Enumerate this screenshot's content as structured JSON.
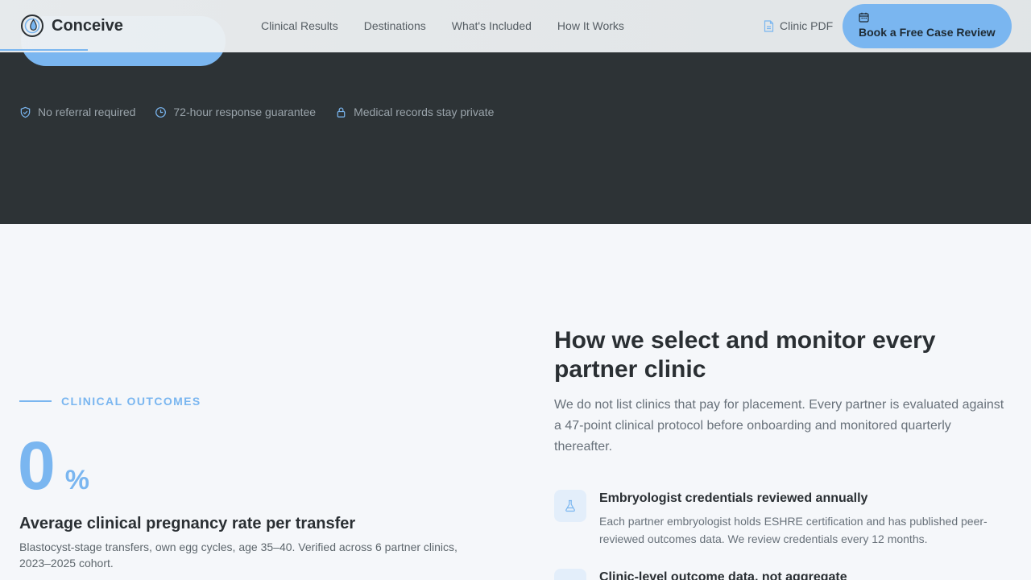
{
  "brand": {
    "name": "Conceive",
    "logo_icon": "droplet-in-circle-icon"
  },
  "nav": {
    "items": [
      "Clinical Results",
      "Destinations",
      "What's Included",
      "How It Works"
    ],
    "pdf_label": "Clinic PDF",
    "cta_label": "Book a Free Case Review"
  },
  "hero": {
    "trust": [
      {
        "icon": "shield-check-icon",
        "label": "No referral required"
      },
      {
        "icon": "clock-icon",
        "label": "72-hour response guarantee"
      },
      {
        "icon": "lock-icon",
        "label": "Medical records stay private"
      }
    ]
  },
  "outcomes": {
    "eyebrow": "CLINICAL OUTCOMES",
    "stat_value": "0",
    "stat_unit": "%",
    "stat_title": "Average clinical pregnancy rate per transfer",
    "stat_description": "Blastocyst-stage transfers, own egg cycles, age 35–40. Verified across 6 partner clinics, 2023–2025 cohort."
  },
  "selection": {
    "heading": "How we select and monitor every partner clinic",
    "intro": "We do not list clinics that pay for placement. Every partner is evaluated against a 47-point clinical protocol before onboarding and monitored quarterly thereafter.",
    "features": [
      {
        "icon": "flask-icon",
        "title": "Embryologist credentials reviewed annually",
        "description": "Each partner embryologist holds ESHRE certification and has published peer-reviewed outcomes data. We review credentials every 12 months."
      },
      {
        "icon": "chart-icon",
        "title": "Clinic-level outcome data, not aggregate",
        "description": ""
      }
    ]
  },
  "colors": {
    "accent": "#7ab6f0",
    "hero_bg": "#2d3336",
    "page_bg": "#f5f7fa"
  }
}
